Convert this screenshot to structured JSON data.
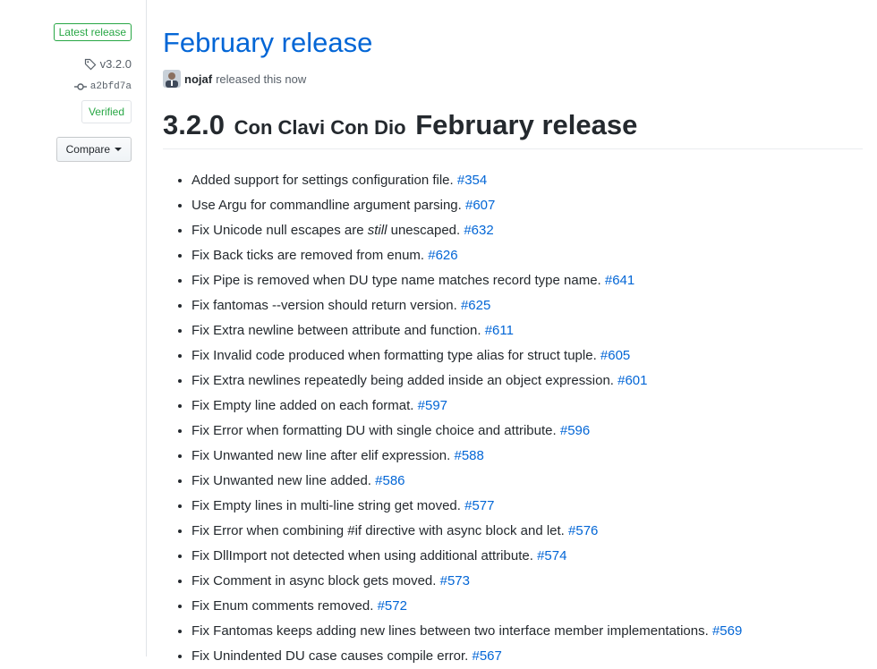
{
  "sidebar": {
    "latest_badge": "Latest release",
    "tag": "v3.2.0",
    "commit": "a2bfd7a",
    "verified": "Verified",
    "compare_label": "Compare"
  },
  "release": {
    "title": "February release",
    "author": "nojaf",
    "released_text": "released this now",
    "heading_version": "3.2.0",
    "heading_codename": "Con Clavi Con Dio",
    "heading_title": "February release"
  },
  "notes": [
    {
      "text": "Added support for settings configuration file.",
      "issue": "#354"
    },
    {
      "text": "Use Argu for commandline argument parsing.",
      "issue": "#607"
    },
    {
      "pre": "Fix Unicode null escapes are ",
      "em": "still",
      "post": " unescaped.",
      "issue": "#632"
    },
    {
      "text": "Fix Back ticks are removed from enum.",
      "issue": "#626"
    },
    {
      "text": "Fix Pipe is removed when DU type name matches record type name.",
      "issue": "#641"
    },
    {
      "text": "Fix fantomas --version should return version.",
      "issue": "#625"
    },
    {
      "text": "Fix Extra newline between attribute and function.",
      "issue": "#611"
    },
    {
      "text": "Fix Invalid code produced when formatting type alias for struct tuple.",
      "issue": "#605"
    },
    {
      "text": "Fix Extra newlines repeatedly being added inside an object expression.",
      "issue": "#601"
    },
    {
      "text": "Fix Empty line added on each format.",
      "issue": "#597"
    },
    {
      "text": "Fix Error when formatting DU with single choice and attribute.",
      "issue": "#596"
    },
    {
      "text": "Fix Unwanted new line after elif expression.",
      "issue": "#588"
    },
    {
      "text": "Fix Unwanted new line added.",
      "issue": "#586"
    },
    {
      "text": "Fix Empty lines in multi-line string get moved.",
      "issue": "#577"
    },
    {
      "text": "Fix Error when combining #if directive with async block and let.",
      "issue": "#576"
    },
    {
      "text": "Fix DllImport not detected when using additional attribute.",
      "issue": "#574"
    },
    {
      "text": "Fix Comment in async block gets moved.",
      "issue": "#573"
    },
    {
      "text": "Fix Enum comments removed.",
      "issue": "#572"
    },
    {
      "text": "Fix Fantomas keeps adding new lines between two interface member implementations.",
      "issue": "#569"
    },
    {
      "text": "Fix Unindented DU case causes compile error.",
      "issue": "#567"
    }
  ],
  "colors": {
    "link": "#0366d6",
    "success": "#28a745",
    "muted": "#586069"
  },
  "icons": {
    "tag": "tag-icon",
    "commit": "git-commit-icon",
    "dropdown": "caret-down-icon"
  }
}
